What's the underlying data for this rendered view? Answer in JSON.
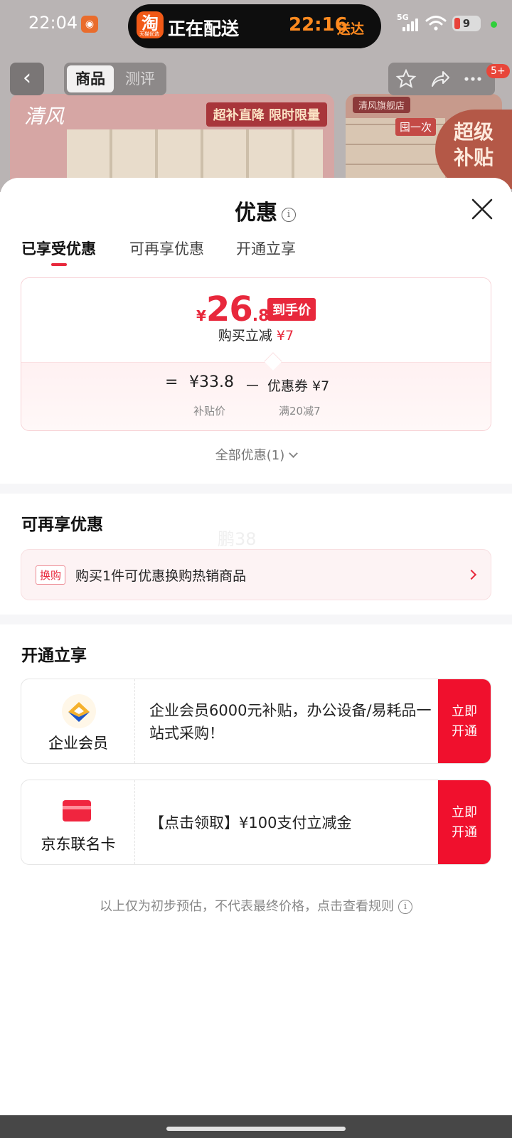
{
  "status_bar": {
    "time": "22:04",
    "island_app_label": "淘",
    "island_app_sub": "天猫优选",
    "delivery_text": "正在配送",
    "eta_time": "22:16",
    "eta_suffix": "送达",
    "network": "5G",
    "battery": "9"
  },
  "product_nav": {
    "tabs": [
      "商品",
      "测评"
    ],
    "badge": "5+"
  },
  "background": {
    "brand": "清风",
    "promo": "超补直降 限时限量",
    "store": "清风旗舰店",
    "slogan": "囤一次",
    "super_badge": [
      "超级",
      "补贴"
    ]
  },
  "sheet": {
    "title": "优惠",
    "tabs": [
      "已享受优惠",
      "可再享优惠",
      "开通立享"
    ],
    "price_card": {
      "currency": "¥",
      "integer": "26",
      "decimal": ".8",
      "tag": "到手价",
      "reduce_label": "购买立减",
      "reduce_amount": "¥7",
      "equals": "=",
      "subsidy_price": "¥33.8",
      "minus": "－",
      "coupon": "优惠券 ¥7",
      "subsidy_label": "补贴价",
      "coupon_rule": "满20减7"
    },
    "all_discounts": "全部优惠(1)",
    "watermark": "鹏38",
    "more_section": {
      "title": "可再享优惠",
      "tag": "换购",
      "text": "购买1件可优惠换购热销商品"
    },
    "open_section": {
      "title": "开通立享",
      "offers": [
        {
          "name": "企业会员",
          "desc": "企业会员6000元补贴，办公设备/易耗品一站式采购！",
          "button": "立即开通"
        },
        {
          "name": "京东联名卡",
          "desc": "【点击领取】¥100支付立减金",
          "button": "立即开通"
        }
      ]
    },
    "footnote": "以上仅为初步预估，不代表最终价格，点击查看规则"
  },
  "colors": {
    "accent_red": "#e8283c",
    "button_red": "#f0102d",
    "eta_orange": "#ff8a1f"
  }
}
